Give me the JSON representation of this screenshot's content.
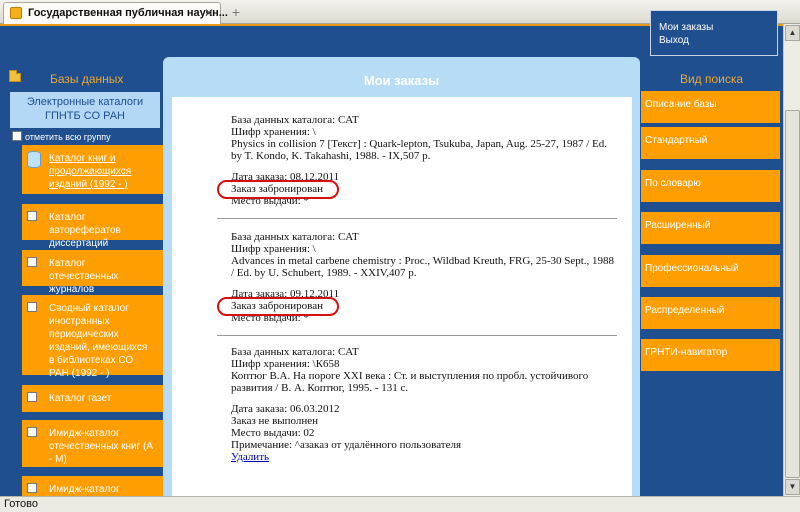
{
  "browser": {
    "tab_title": "Государственная публичная научн...",
    "close_glyph": "✕",
    "new_tab_glyph": "+",
    "status": "Готово"
  },
  "header": {
    "user_menu": [
      "Мои заказы",
      "Выход"
    ]
  },
  "left": {
    "title": "Базы данных",
    "active_catalog": "Электронные каталоги ГПНТБ СО РАН",
    "select_all": "отметить всю группу",
    "items": [
      {
        "label": "Каталог книг и продолжающихся изданий (1992 - )",
        "active": true
      },
      {
        "label": "Каталог авторефератов диссертаций",
        "active": false
      },
      {
        "label": "Каталог отечественных журналов",
        "active": false
      },
      {
        "label": "Сводный каталог иностранных периодических изданий, имеющихся в библиотеках СО РАН (1992 - )",
        "active": false
      },
      {
        "label": "Каталог газет",
        "active": false
      },
      {
        "label": "Имидж-каталог отечественных книг (А - М)",
        "active": false
      },
      {
        "label": "Имидж-каталог",
        "active": false
      }
    ]
  },
  "main": {
    "title": "Мои заказы",
    "orders": [
      {
        "db": "База данных каталога: CAT",
        "shelf": "Шифр хранения: \\",
        "desc": "Physics in collision 7 [Текст] : Quark-lepton, Tsukuba, Japan, Aug. 25-27, 1987 / Ed. by T. Kondo, K. Takahashi, 1988. - IX,507 p.",
        "date": "Дата заказа: 08.12.2011",
        "status": "Заказ забронирован",
        "place": "Место выдачи: *"
      },
      {
        "db": "База данных каталога: CAT",
        "shelf": "Шифр хранения: \\",
        "desc": "Advances in metal carbene chemistry : Proc., Wildbad Kreuth, FRG, 25-30 Sept., 1988 / Ed. by U. Schubert, 1989. - XXIV,407 p.",
        "date": "Дата заказа: 09.12.2011",
        "status": "Заказ забронирован",
        "place": "Место выдачи: *"
      },
      {
        "db": "База данных каталога: CAT",
        "shelf": "Шифр хранения: \\К658",
        "desc": "Коптюг В.А. На пороге XXI века : Ст. и выступления по пробл. устойчивого развития / В. А. Коптюг, 1995. - 131 с.",
        "date": "Дата заказа: 06.03.2012",
        "status": "Заказ не выполнен",
        "place": "Место выдачи: 02",
        "note": "Примечание: ^азаказ от удалённого пользователя",
        "delete": "Удалить"
      }
    ]
  },
  "right": {
    "title": "Вид поиска",
    "items": [
      "Описание базы",
      "Стандартный",
      "По словарю",
      "Расширенный",
      "Профессиональный",
      "Распределенный",
      "ГРНТИ-навигатор"
    ]
  },
  "scrollbar": {
    "up_glyph": "▲",
    "down_glyph": "▼"
  }
}
